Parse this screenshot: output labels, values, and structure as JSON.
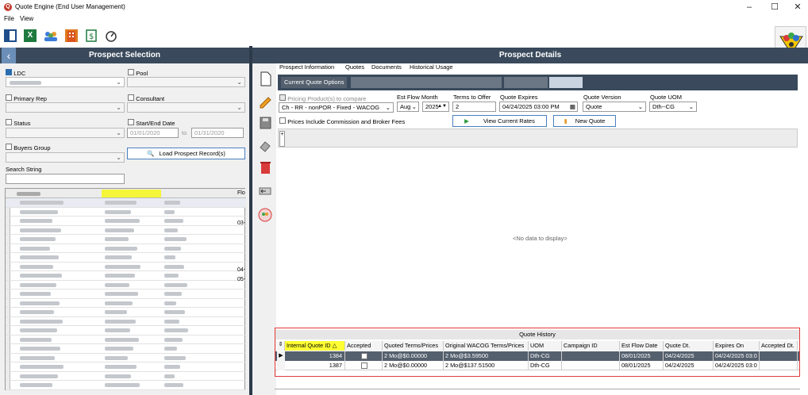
{
  "window": {
    "title": "Quote Engine (End User Management)"
  },
  "menu": [
    "File",
    "View"
  ],
  "left": {
    "header": "Prospect Selection",
    "ldc_label": "LDC",
    "pool_label": "Pool",
    "primary_rep_label": "Primary Rep",
    "consultant_label": "Consultant",
    "status_label": "Status",
    "start_end_label": "Start/End Date",
    "start_date": "01/01/2020",
    "end_date": "01/31/2020",
    "to_label": "to",
    "buyers_group_label": "Buyers Group",
    "load_button": "Load Prospect Record(s)",
    "search_label": "Search String",
    "grid_fragments": [
      "Flo",
      "03-",
      "04-",
      "05-"
    ]
  },
  "right": {
    "header": "Prospect Details",
    "tabs": [
      "Prospect Information",
      "Quotes",
      "Documents",
      "Historical Usage"
    ],
    "subtab": "Current Quote Options",
    "pricing_label": "Pricing Product(s) to compare",
    "product_value": "Ch - RR - nonPOR - Fixed - WACOG",
    "est_flow_label": "Est Flow Month",
    "month_value": "Aug",
    "year_value": "2025",
    "terms_label": "Terms to Offer",
    "terms_value": "2",
    "expires_label": "Quote Expires",
    "expires_value": "04/24/2025 03:00 PM",
    "version_label": "Quote Version",
    "version_value": "Quote",
    "uom_label": "Quote UOM",
    "uom_value": "Dth--CG",
    "include_commission_label": "Prices Include Commission and Broker Fees",
    "view_rates_button": "View Current Rates",
    "new_quote_button": "New Quote",
    "no_data": "<No data to display>"
  },
  "quote_history": {
    "title": "Quote History",
    "columns": [
      "Internal Quote ID",
      "Accepted",
      "Quoted Terms/Prices",
      "Original WACOG Terms/Prices",
      "UOM",
      "Campaign ID",
      "Est Flow Date",
      "Quote Dt.",
      "Expires On",
      "Accepted Dt."
    ],
    "rows": [
      {
        "id": "1384",
        "terms": "2 Mo@$0.00000",
        "wacog": "2 Mo@$3.59500",
        "uom": "Dth-CG",
        "campaign": "",
        "flow": "08/01/2025",
        "quote_dt": "04/24/2025",
        "expires": "04/24/2025 03:0",
        "accepted_dt": ""
      },
      {
        "id": "1387",
        "terms": "2 Mo@$0.00000",
        "wacog": "2 Mo@$137.51500",
        "uom": "Dth-CG",
        "campaign": "",
        "flow": "08/01/2025",
        "quote_dt": "04/24/2025",
        "expires": "04/24/2025 03:0",
        "accepted_dt": ""
      }
    ]
  },
  "colors": {
    "header": "#3a4a5c",
    "highlight": "#ffff33",
    "selected_row": "#55606e",
    "accent_red": "#e03a3a"
  }
}
